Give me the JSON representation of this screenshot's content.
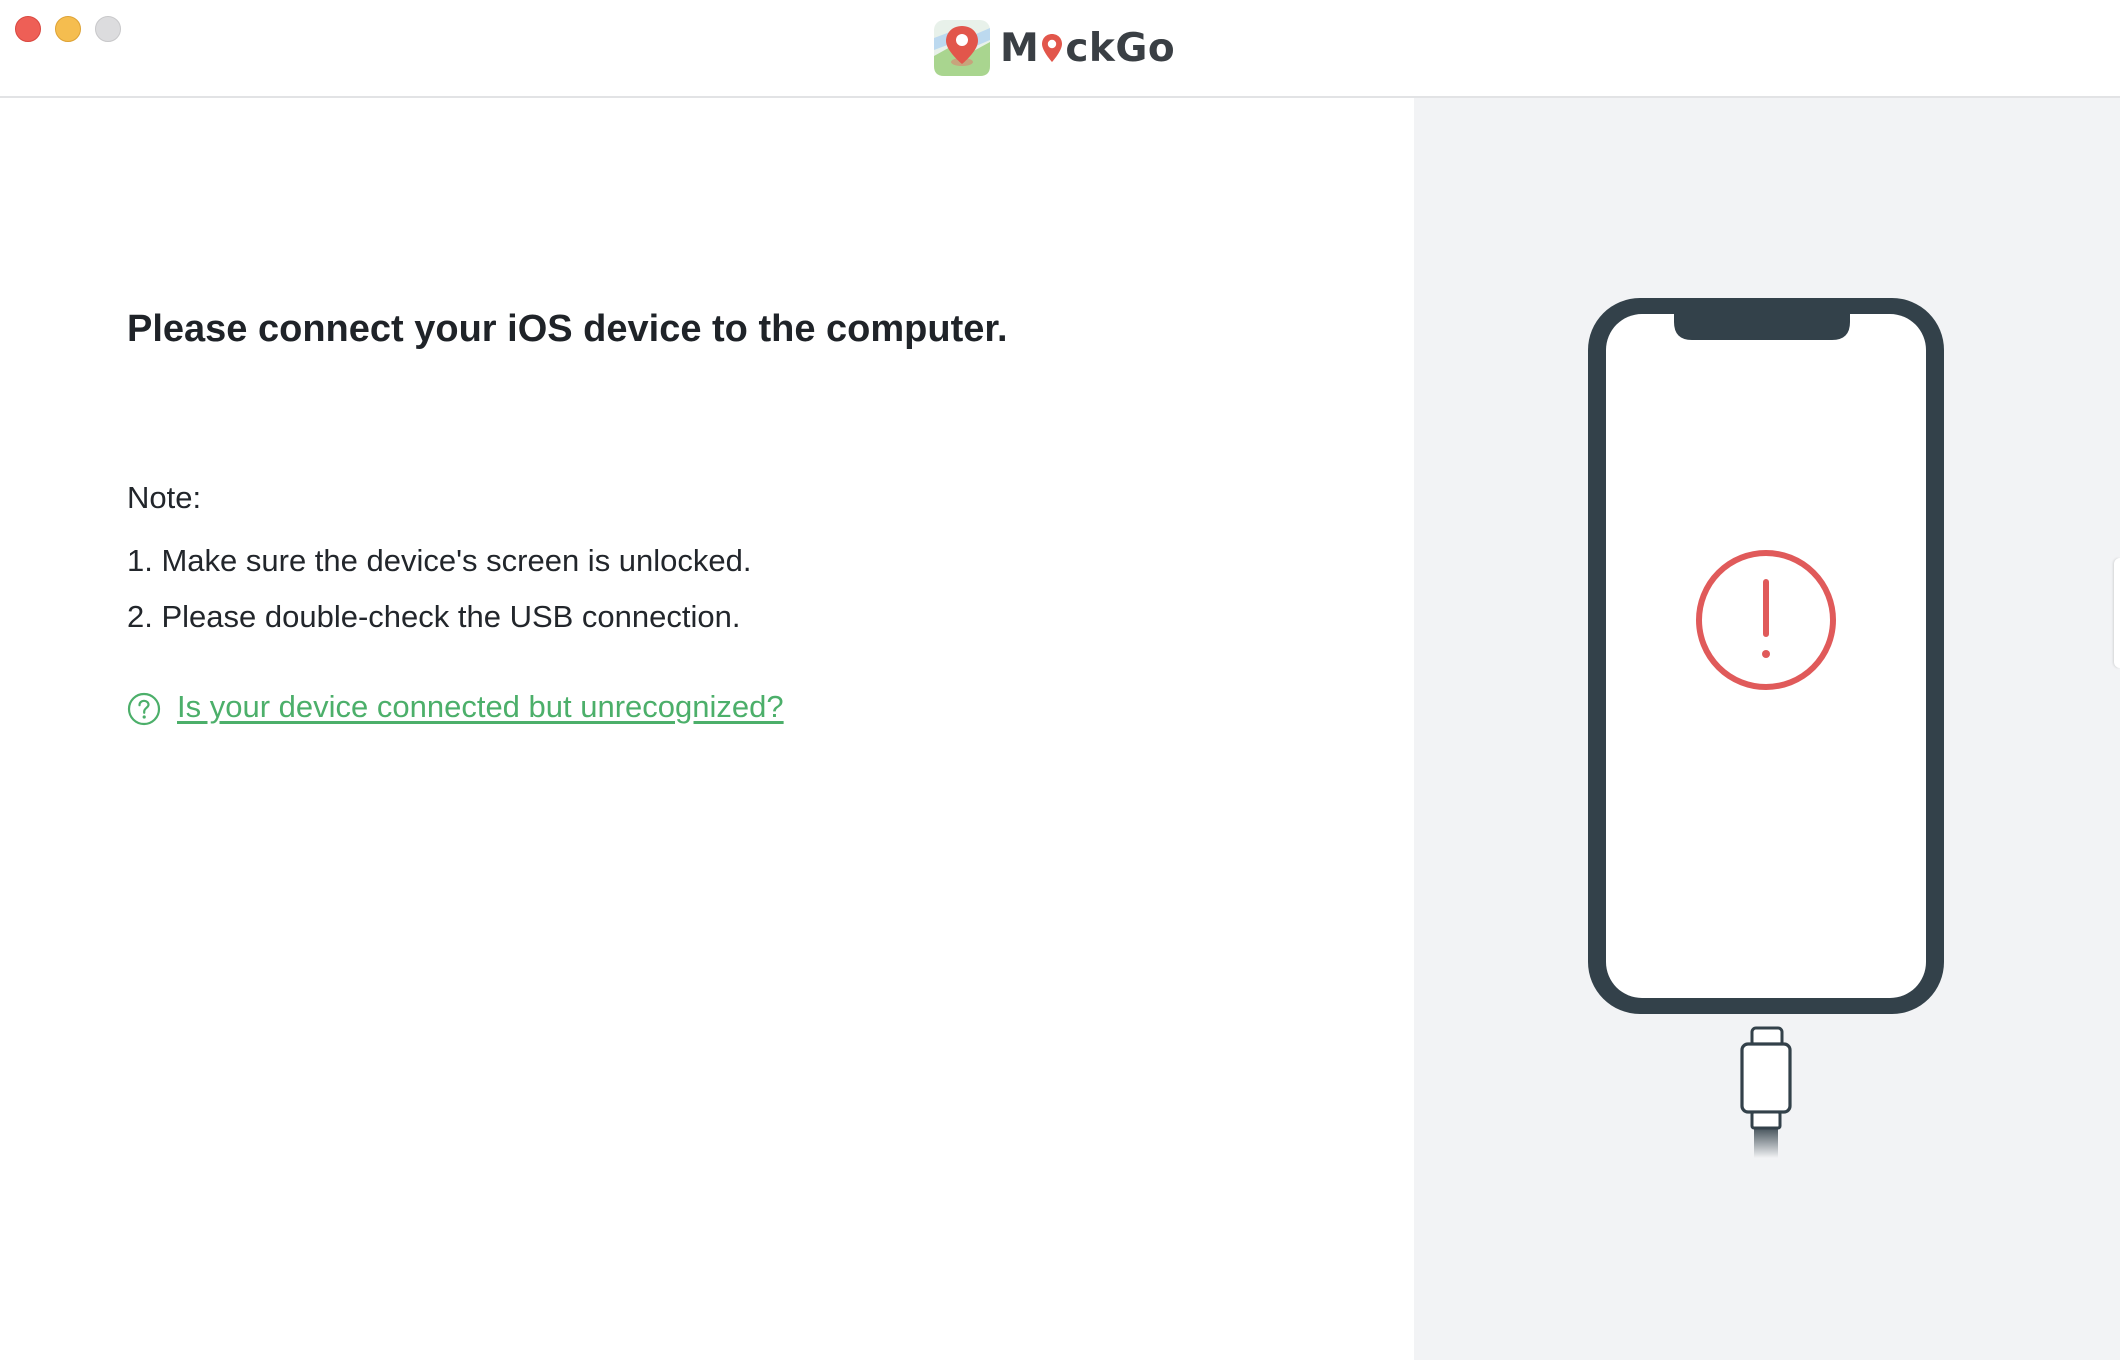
{
  "app": {
    "name": "MockGo",
    "name_prefix": "M",
    "name_suffix": "ckGo"
  },
  "window_controls": {
    "close": "close",
    "minimize": "minimize",
    "maximize": "maximize"
  },
  "main": {
    "heading": "Please connect your iOS device to the computer.",
    "note_label": "Note:",
    "notes": [
      "1. Make sure the device's screen is unlocked.",
      "2. Please double-check the USB connection."
    ],
    "help_link": "Is your device connected but unrecognized?"
  },
  "illustration": {
    "device": "iphone-icon",
    "status": "warning-icon",
    "cable": "usb-cable-icon"
  },
  "colors": {
    "accent_green": "#4caf6a",
    "warning_red": "#e05a5a",
    "phone_frame": "#33414a",
    "right_panel_bg": "#f2f3f5"
  }
}
